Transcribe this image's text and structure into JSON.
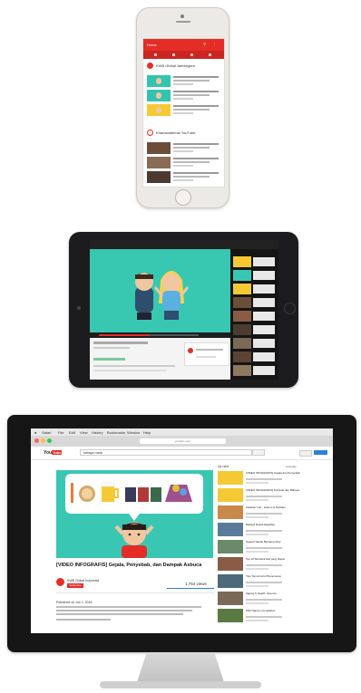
{
  "phone": {
    "app_title": "Home",
    "channel_section": "KWB Global Jamsegera",
    "channel_section2": "Khanacademia YouTube"
  },
  "monitor": {
    "mac_menu": [
      "Safari",
      "File",
      "Edit",
      "View",
      "History",
      "Bookmarks",
      "Window",
      "Help"
    ],
    "url": "youtube.com",
    "logo": "You",
    "logo_tube": "Tube",
    "search_value": "bahaya rokok",
    "video_title": "[VIDEO INFOGRAFIS] Gejala, Penyebab, dan Dampak Asbuca",
    "channel_name": "KWB Global Indonesia",
    "subscribe_label": "Subscribe",
    "views": "1,754 views",
    "published": "Published on Jun 1, 2016",
    "up_next": "Up next",
    "autoplay": "Autoplay",
    "sidebar_titles": [
      "[VIDEO INFOGRAFIS] Gejala dan Penyebab",
      "[VIDEO INFOGRAFIS] Dampak dan Bahaya",
      "Karakter Lari - Hukum & Perilaku",
      "Bahaya Rokok Eligibility",
      "Ngeteh Santai Bersama Fitur",
      "Top 10 Merokok Hal yang Dapat",
      "Tips Tomorrow's Phenomena",
      "Vaping & Health, Science",
      "Wild Nature Compilation"
    ]
  },
  "colors": {
    "youtube_red": "#e52d27",
    "teal": "#39c7b3",
    "yellow": "#f5c933"
  }
}
